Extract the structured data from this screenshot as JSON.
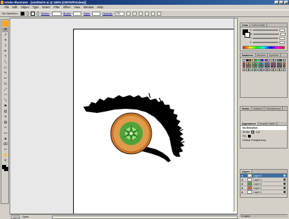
{
  "window": {
    "title": "Adobe Illustrator - [Untitled-5 ai @ 150% (CMYK/Preview)]",
    "controls": [
      "_",
      "□",
      "×"
    ]
  },
  "menu": [
    "File",
    "Edit",
    "Object",
    "Type",
    "Select",
    "Filter",
    "Effect",
    "View",
    "Window",
    "Help"
  ],
  "control_bar": {
    "selection": "No Selection",
    "fill_color": "#000000",
    "stroke_color": "#000000",
    "stroke_label": "Stroke:",
    "brush_label": "Brush:",
    "style_label": "Style:",
    "opacity_label": "Opacity:",
    "opacity_value": "100"
  },
  "toolbox": {
    "tools": [
      "selection-tool",
      "direct-selection-tool",
      "magic-wand-tool",
      "lasso-tool",
      "pen-tool",
      "type-tool",
      "line-tool",
      "rectangle-tool",
      "paintbrush-tool",
      "pencil-tool",
      "rotate-tool",
      "scale-tool",
      "warp-tool",
      "free-transform-tool",
      "symbol-sprayer-tool",
      "graph-tool",
      "mesh-tool",
      "gradient-tool",
      "eyedropper-tool",
      "blend-tool",
      "live-paint-tool",
      "slice-tool",
      "scissors-tool",
      "hand-tool",
      "zoom-tool"
    ],
    "glyphs": [
      "➤",
      "⇗",
      "✦",
      "ℓ",
      "✒",
      "T",
      "╲",
      "▭",
      "✎",
      "✏",
      "↻",
      "⤢",
      "〰",
      "⤡",
      "✺",
      "▥",
      "⌗",
      "▤",
      "✑",
      "⊶",
      "◈",
      "⌧",
      "✂",
      "✋",
      "⚲"
    ]
  },
  "status": {
    "zoom": "150%",
    "status_text": "Open"
  },
  "color_panel": {
    "tabs": [
      "Color",
      "Color Guide"
    ],
    "channels": [
      "C",
      "M",
      "Y",
      "K"
    ]
  },
  "swatches_panel": {
    "tabs": [
      "Swatches",
      "Brushes",
      "Symbols"
    ],
    "colors": [
      "#ffffff",
      "#000000",
      "#ff0000",
      "#ffff00",
      "#00ff00",
      "#00ffff",
      "#0000ff",
      "#ff00ff",
      "#ffc0c0",
      "#c0ffc0",
      "#c0c0ff",
      "#808080",
      "#404040",
      "#c0c0c0",
      "#e31d1d",
      "#f39c12",
      "#f1c40f",
      "#8bc34a",
      "#2ecc71",
      "#1abc9c",
      "#3498db",
      "#2980b9",
      "#9b59b6",
      "#8e44ad",
      "#e91e63",
      "#795548",
      "#607d8b",
      "#ff5722",
      "#c0392b",
      "#d35400",
      "#b7950b",
      "#4caf50",
      "#27ae60",
      "#16a085",
      "#2471a3",
      "#1f4e79",
      "#6c3483",
      "#4a235a",
      "#ad1457",
      "#5d4037",
      "#37474f",
      "#bf360c",
      "#f5b7b1",
      "#fad7a0",
      "#f9e79f",
      "#abebc6",
      "#a3e4d7",
      "#aed6f1",
      "#d2b4de",
      "#f8bbd0",
      "#d7ccc8",
      "#cfd8dc",
      "#ffe0b2",
      "#fff9c4",
      "#dcedc8",
      "#b3e5fc"
    ]
  },
  "appearance_panel": {
    "tabs": [
      "Stroke",
      "Gradient",
      "Transparency"
    ],
    "tabs2": [
      "Appearance",
      "Graphic Styles"
    ],
    "header": "No Selection",
    "rows": [
      {
        "label": "Stroke:",
        "value": "1 pt"
      },
      {
        "label": "Fill:",
        "value": ""
      },
      {
        "label": "Default Transparency",
        "value": ""
      }
    ]
  },
  "layers_panel": {
    "tabs": [
      "Layers"
    ],
    "layers": [
      {
        "name": "Layer 5",
        "selected": true
      },
      {
        "name": "Layer 4",
        "selected": false
      },
      {
        "name": "Layer 3",
        "selected": false
      },
      {
        "name": "Layer 2",
        "selected": false
      },
      {
        "name": "Layer 1",
        "selected": false
      }
    ],
    "footer": "5 Layers"
  },
  "colors": {
    "iris_outer": "#c7732a",
    "iris_inner": "#e09a4b",
    "pupil_green": "#4fa33a",
    "highlight": "#9be07a",
    "lash": "#000000"
  }
}
